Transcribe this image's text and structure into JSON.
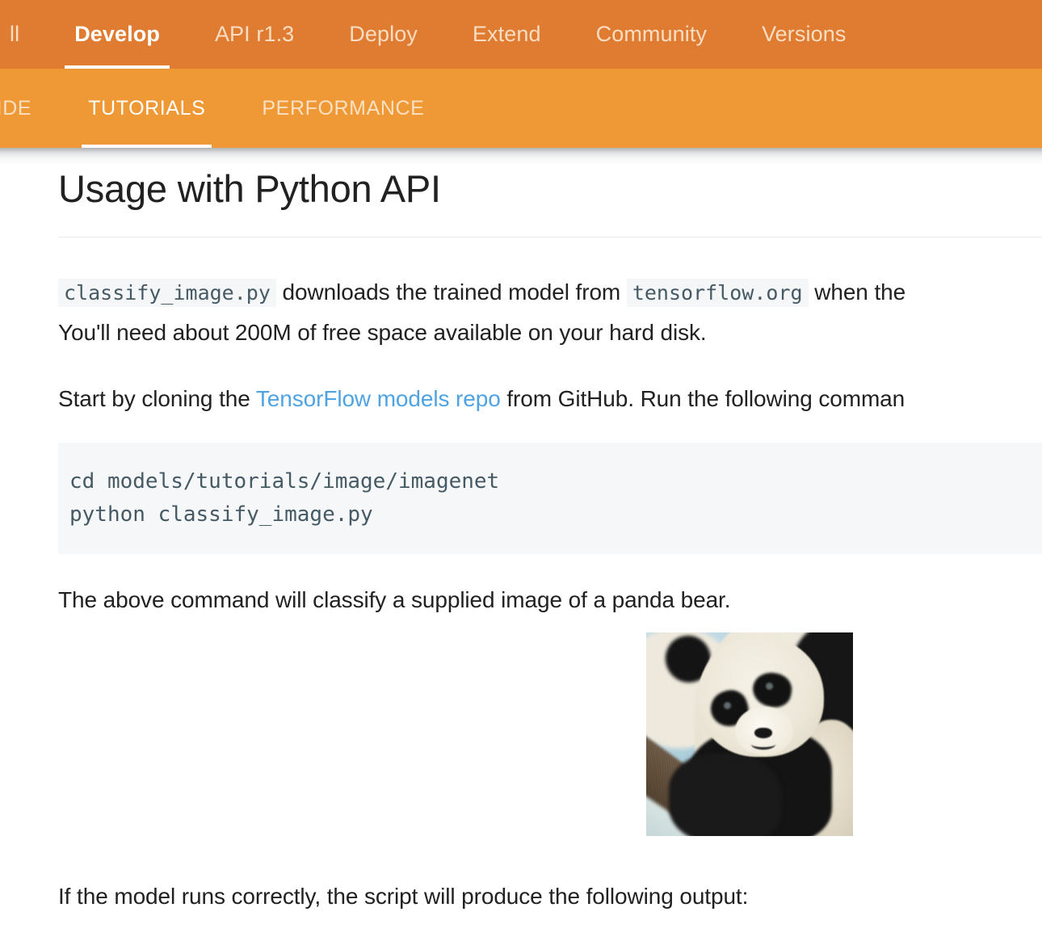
{
  "topnav": {
    "items": [
      {
        "label": "ll",
        "active": false
      },
      {
        "label": "Develop",
        "active": true
      },
      {
        "label": "API r1.3",
        "active": false
      },
      {
        "label": "Deploy",
        "active": false
      },
      {
        "label": "Extend",
        "active": false
      },
      {
        "label": "Community",
        "active": false
      },
      {
        "label": "Versions",
        "active": false
      }
    ],
    "background_color": "#e07b32",
    "active_color": "#ffffff",
    "inactive_color": "#fbddc2"
  },
  "subnav": {
    "items": [
      {
        "label": "UIDE",
        "active": false
      },
      {
        "label": "TUTORIALS",
        "active": true
      },
      {
        "label": "PERFORMANCE",
        "active": false
      }
    ],
    "background_color": "#ef9936",
    "active_color": "#ffffff",
    "inactive_color": "#fce0c3"
  },
  "main": {
    "title": "Usage with Python API",
    "paragraph1": {
      "code1": "classify_image.py",
      "text1": " downloads the trained model from ",
      "code2": "tensorflow.org",
      "text2": " when the",
      "line2": "You'll need about 200M of free space available on your hard disk."
    },
    "paragraph2": {
      "before_link": "Start by cloning the ",
      "link_text": "TensorFlow models repo",
      "link_color": "#4fa3e3",
      "after_link": " from GitHub. Run the following comman"
    },
    "codeblock": "cd models/tutorials/image/imagenet\npython classify_image.py",
    "paragraph3": "The above command will classify a supplied image of a panda bear.",
    "figure_alt": "panda-photo",
    "paragraph4": "If the model runs correctly, the script will produce the following output:"
  }
}
